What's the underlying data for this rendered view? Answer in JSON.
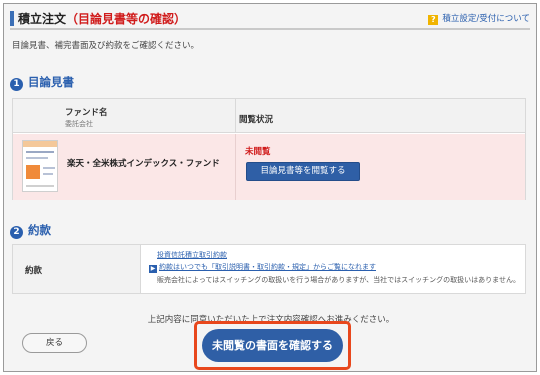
{
  "header": {
    "title_prefix": "積立注文",
    "title_red": "（目論見書等の確認）",
    "help_link": "積立設定/受付について",
    "help_icon": "question-icon"
  },
  "intro": "目論見書、補完書面及び約款をご確認ください。",
  "section1": {
    "num": "1",
    "title": "目論見書"
  },
  "prospectus_table": {
    "col_fund": "ファンド名",
    "col_fund_sub": "委託会社",
    "col_status": "閲覧状況",
    "rows": [
      {
        "fund_name": "楽天・全米株式インデックス・ファンド",
        "status": "未閲覧",
        "button": "目論見書等を閲覧する"
      }
    ]
  },
  "section2": {
    "num": "2",
    "title": "約款"
  },
  "terms_table": {
    "label": "約款",
    "link1": "投資信託積立取引約款",
    "link2": "約款はいつでも「取引説明書・取引約款・規定」からご覧になれます",
    "note": "販売会社によってはスイッチングの取扱いを行う場合がありますが、当社ではスイッチングの取扱いはありません。"
  },
  "agree_text": "上記内容に同意いただいた上で注文内容確認へお進みください。",
  "buttons": {
    "back": "戻る",
    "confirm": "未閲覧の書面を確認する"
  },
  "colors": {
    "accent": "#2f5fa6",
    "alert_red": "#d01b1b",
    "highlight_orange": "#e8471c",
    "row_pink": "#fbe7e7"
  }
}
